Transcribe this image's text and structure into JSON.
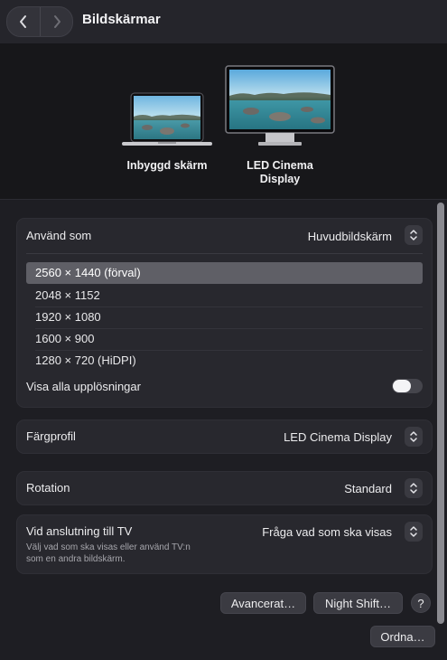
{
  "window": {
    "title": "Bildskärmar"
  },
  "displays": [
    {
      "label": "Inbyggd skärm"
    },
    {
      "label_line1": "LED Cinema",
      "label_line2": "Display"
    }
  ],
  "main_display": {
    "label": "Använd som",
    "value": "Huvudbildskärm",
    "resolutions": [
      "2560 × 1440 (förval)",
      "2048 × 1152",
      "1920 × 1080",
      "1600 × 900",
      "1280 × 720 (HiDPI)"
    ],
    "selected_resolution_index": 0,
    "show_all_label": "Visa alla upplösningar",
    "show_all_enabled": false
  },
  "color_profile": {
    "label": "Färgprofil",
    "value": "LED Cinema Display"
  },
  "rotation": {
    "label": "Rotation",
    "value": "Standard"
  },
  "tv": {
    "label": "Vid anslutning till TV",
    "value": "Fråga vad som ska visas",
    "description_line1": "Välj vad som ska visas eller använd TV:n",
    "description_line2": "som en andra bildskärm."
  },
  "buttons": {
    "advanced": "Avancerat…",
    "night_shift": "Night Shift…",
    "help": "?",
    "arrange": "Ordna…"
  },
  "icons": {
    "back": "chevron-left-icon",
    "forward": "chevron-right-icon",
    "stepper": "up-down-chevron-icon"
  },
  "colors": {
    "background": "#1e1e23",
    "group": "#28282e",
    "selected_row": "#5f5f66"
  }
}
